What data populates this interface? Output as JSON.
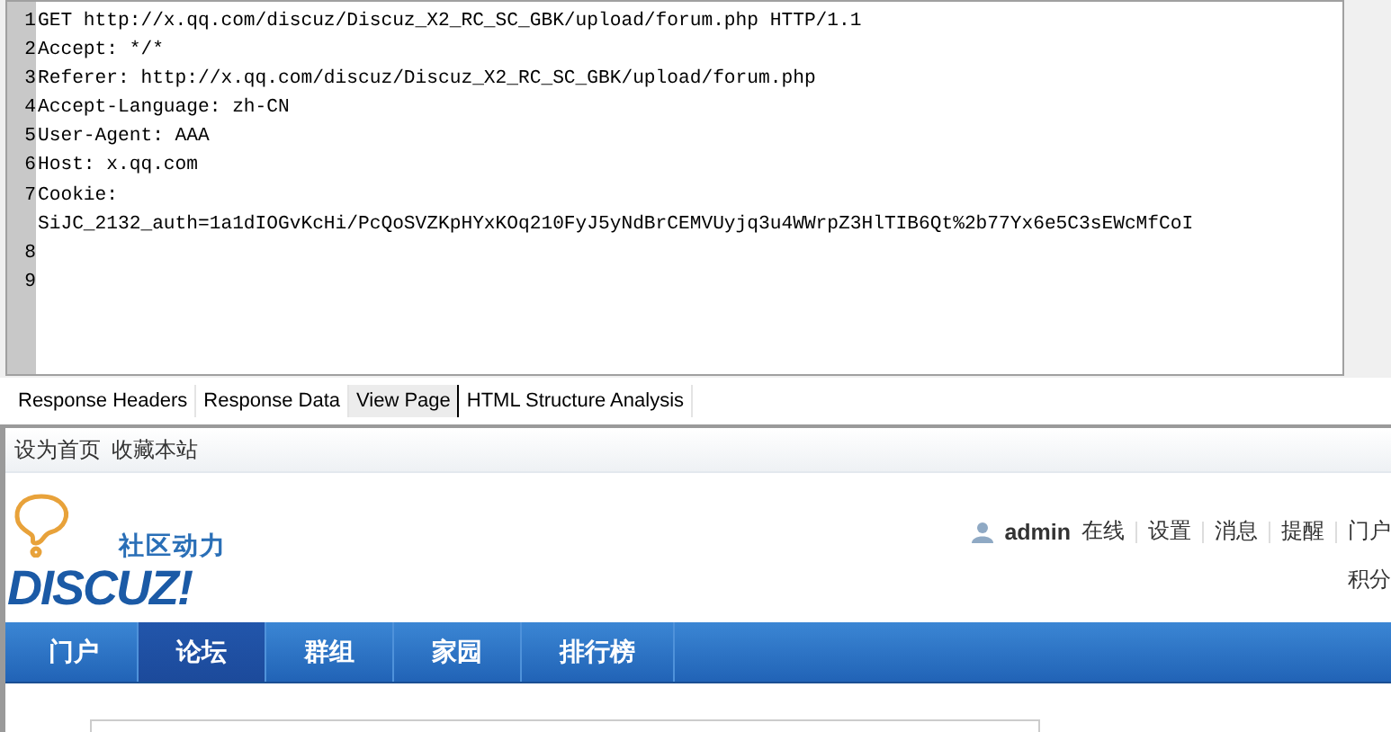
{
  "request_editor": {
    "lines": [
      {
        "number": "1",
        "text": [
          "GET http://x.qq.com/discuz/Discuz_X2_RC_SC_GBK/upload/forum.php HTTP/1.1"
        ]
      },
      {
        "number": "2",
        "text": [
          "Accept: */*"
        ]
      },
      {
        "number": "3",
        "text": [
          "Referer: http://x.qq.com/discuz/Discuz_X2_RC_SC_GBK/upload/forum.php"
        ]
      },
      {
        "number": "4",
        "text": [
          "Accept-Language: zh-CN"
        ]
      },
      {
        "number": "5",
        "text": [
          "User-Agent: AAA"
        ]
      },
      {
        "number": "6",
        "text": [
          "Host: x.qq.com"
        ]
      },
      {
        "number": "7",
        "text": [
          "Cookie:",
          "SiJC_2132_auth=1a1dIOGvKcHi/PcQoSVZKpHYxKOq210FyJ5yNdBrCEMVUyjq3u4WWrpZ3HlTIB6Qt%2b77Yx6e5C3sEWcMfCoI"
        ]
      },
      {
        "number": "8"
      },
      {
        "number": "9"
      }
    ]
  },
  "tabs": [
    {
      "label": "Response Headers",
      "selected": false
    },
    {
      "label": "Response Data",
      "selected": false
    },
    {
      "label": "View Page",
      "selected": true
    },
    {
      "label": "HTML Structure Analysis",
      "selected": false
    }
  ],
  "page": {
    "top_links": [
      "设为首页",
      "收藏本站"
    ],
    "logo": {
      "tagline": "社区动力",
      "wordmark": "DISCUZ!"
    },
    "user_bar": {
      "username": "admin",
      "status": "在线",
      "links": [
        "设置",
        "消息",
        "提醒",
        "门户"
      ]
    },
    "credits": "积分",
    "nav": [
      {
        "label": "门户",
        "selected": false
      },
      {
        "label": "论坛",
        "selected": true
      },
      {
        "label": "群组",
        "selected": false
      },
      {
        "label": "家园",
        "selected": false
      },
      {
        "label": "排行榜",
        "selected": false
      }
    ]
  }
}
